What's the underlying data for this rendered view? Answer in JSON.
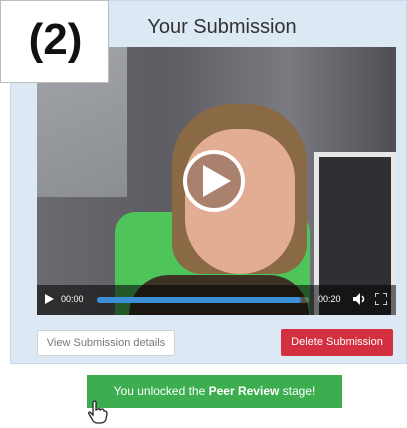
{
  "step_label": "(2)",
  "header": {
    "title": "Your Submission"
  },
  "video": {
    "current_time": "00:00",
    "duration": "00:20",
    "progress_fraction": 0.0,
    "buffered_fraction": 0.96,
    "icons": [
      "play-icon",
      "volume-icon",
      "fullscreen-icon"
    ]
  },
  "actions": {
    "details_label": "View Submission details",
    "delete_label": "Delete Submission"
  },
  "banner": {
    "prefix": "You unlocked the ",
    "emphasis": "Peer Review",
    "suffix": " stage!"
  },
  "colors": {
    "panel": "#dde8f5",
    "delete": "#d32f3f",
    "banner": "#3dae4f",
    "progress": "#3a8fd6"
  }
}
